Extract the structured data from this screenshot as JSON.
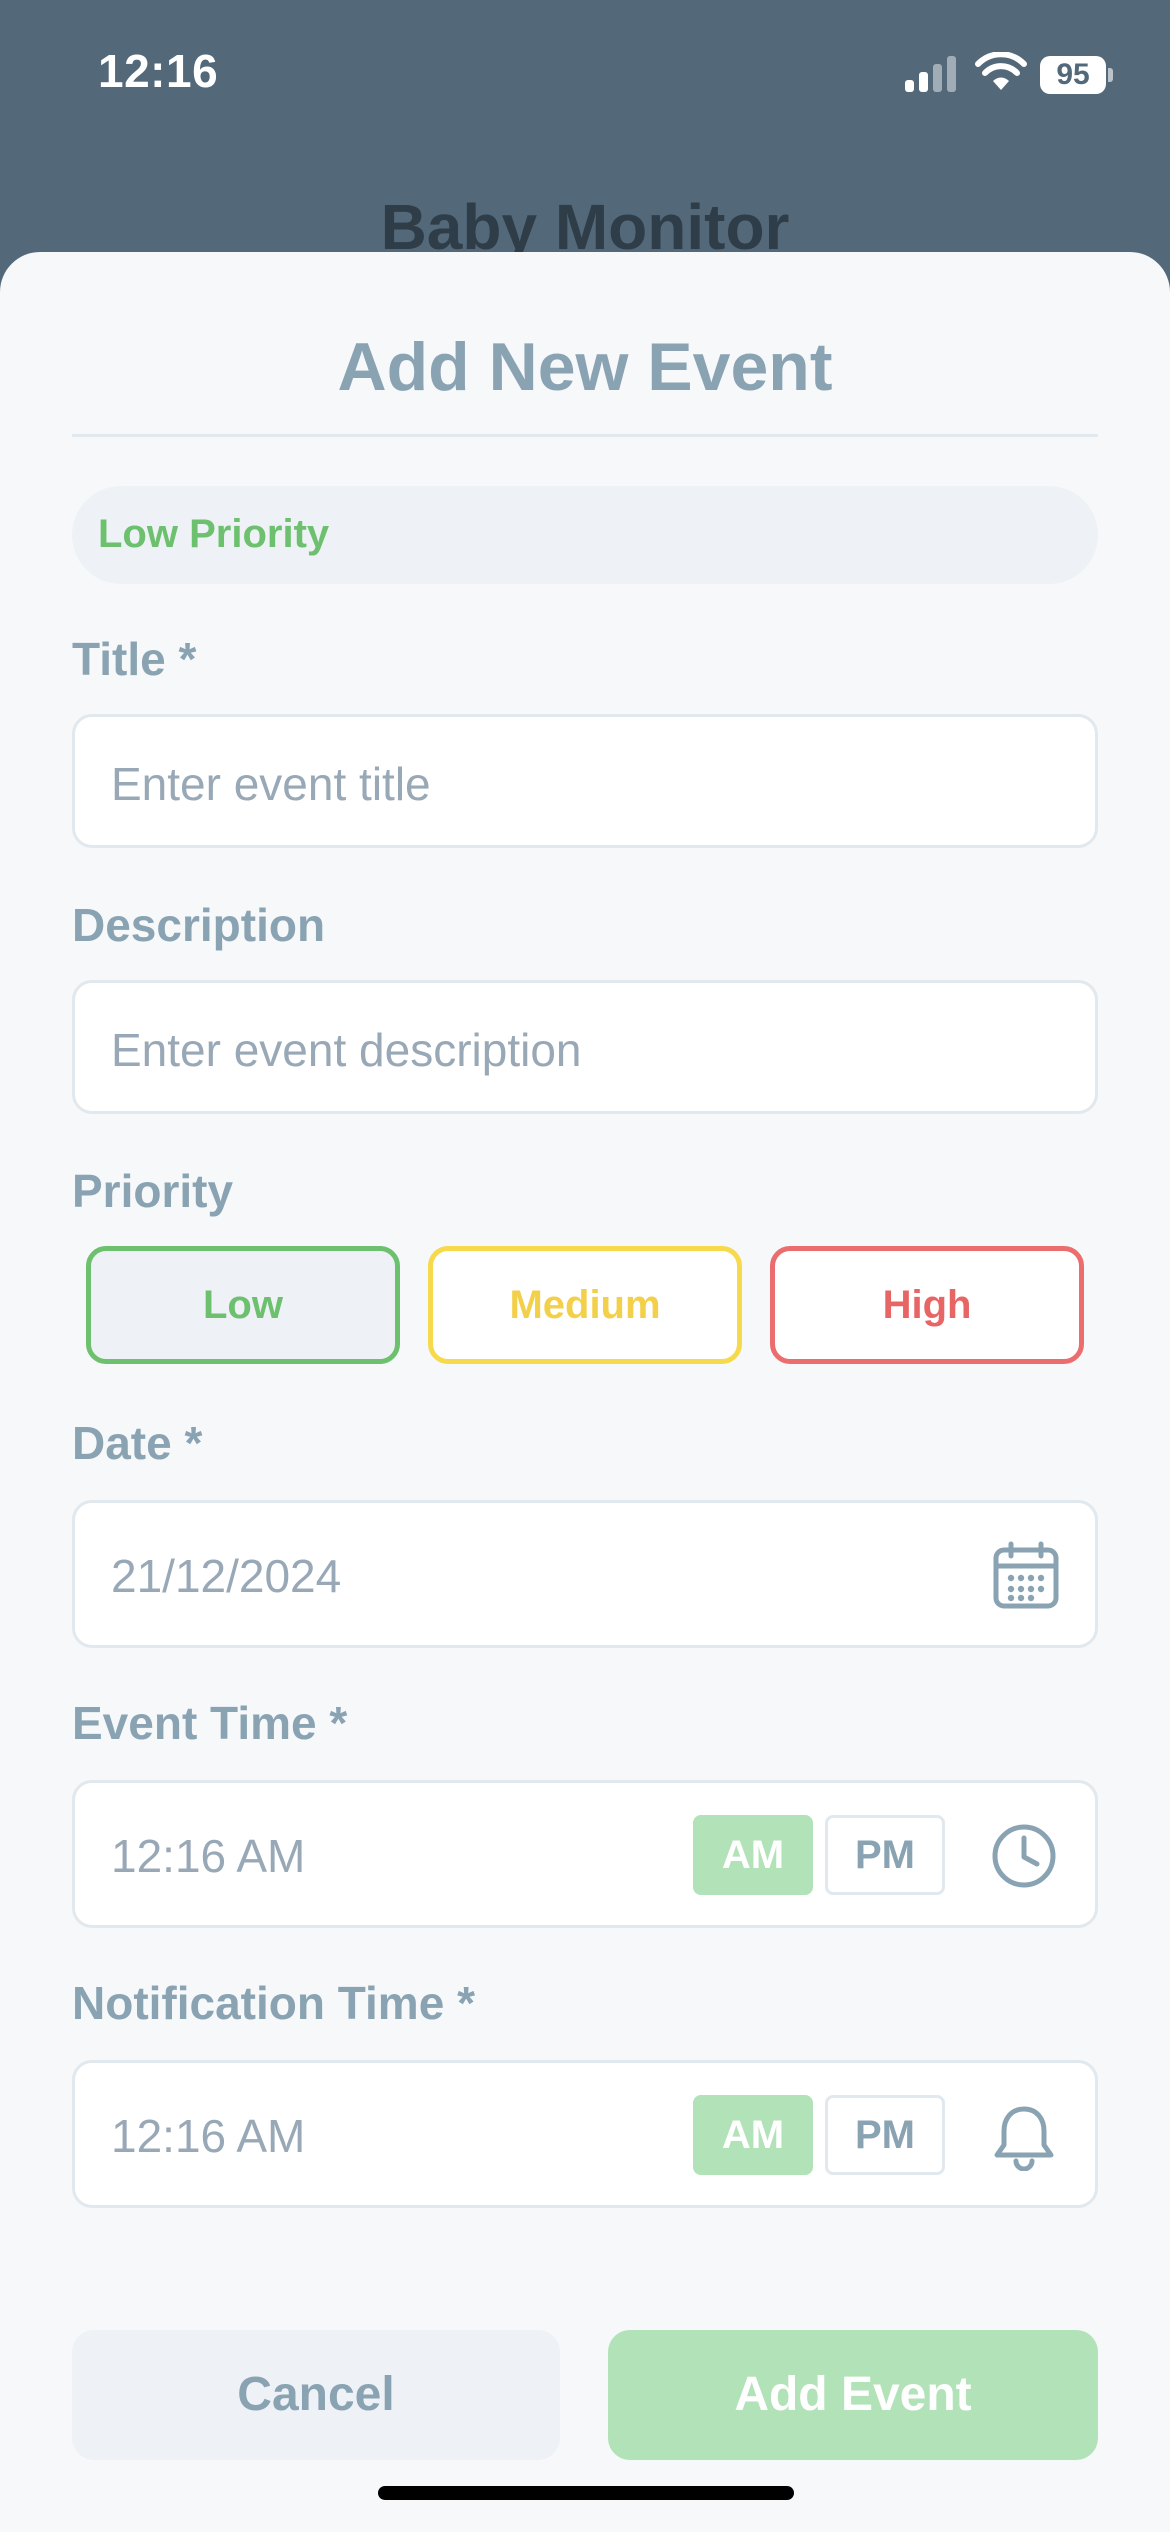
{
  "status_bar": {
    "time": "12:16",
    "battery": "95"
  },
  "background_title": "Baby Monitor",
  "sheet": {
    "title": "Add New Event",
    "priority_banner": "Low Priority"
  },
  "form": {
    "title_label": "Title *",
    "title_placeholder": "Enter event title",
    "description_label": "Description",
    "description_placeholder": "Enter event description",
    "priority_label": "Priority",
    "priority_options": [
      "Low",
      "Medium",
      "High"
    ],
    "priority_selected": "Low",
    "date_label": "Date *",
    "date_value": "21/12/2024",
    "event_time_label": "Event Time *",
    "event_time_value": "12:16 AM",
    "notification_time_label": "Notification Time *",
    "notification_time_value": "12:16 AM",
    "am_label": "AM",
    "pm_label": "PM",
    "period_selected": "AM"
  },
  "actions": {
    "cancel": "Cancel",
    "add": "Add Event"
  },
  "colors": {
    "header_bg": "#53697a",
    "sheet_bg": "#f6f8fa",
    "accent_text": "#8aa3b3",
    "low": "#6cc06e",
    "medium": "#f7d94c",
    "high": "#ec6d6d",
    "add_button": "#b2e2b7"
  },
  "icons": [
    "calendar-icon",
    "clock-icon",
    "bell-icon",
    "signal-icon",
    "wifi-icon",
    "battery-icon"
  ]
}
